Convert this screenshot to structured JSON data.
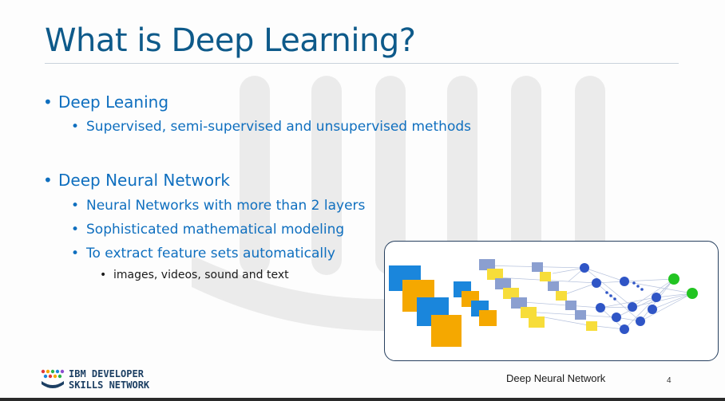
{
  "slide": {
    "title": "What is Deep Learning?",
    "bullets": [
      {
        "level": 1,
        "text": "Deep Leaning"
      },
      {
        "level": 2,
        "text": "Supervised, semi-supervised and unsupervised methods"
      },
      {
        "level": 1,
        "text": "Deep Neural Network"
      },
      {
        "level": 2,
        "text": "Neural Networks with more than 2 layers"
      },
      {
        "level": 2,
        "text": "Sophisticated mathematical modeling"
      },
      {
        "level": 2,
        "text": "To extract feature sets automatically"
      },
      {
        "level": 3,
        "text": "images, videos, sound and text"
      }
    ],
    "caption": "Deep Neural Network",
    "page_number": "4",
    "logo": {
      "line1": "IBM DEVELOPER",
      "line2": "SKILLS NETWORK"
    }
  },
  "colors": {
    "title": "#0e5a8a",
    "bullet": "#0f6fbf",
    "diagram_blue": "#1a86dc",
    "diagram_orange": "#f5a800",
    "diagram_slate": "#8b9fd0",
    "diagram_yellow": "#f7dd3a",
    "node_blue": "#2f55c6",
    "node_green": "#22c422",
    "box_border": "#27405f"
  }
}
